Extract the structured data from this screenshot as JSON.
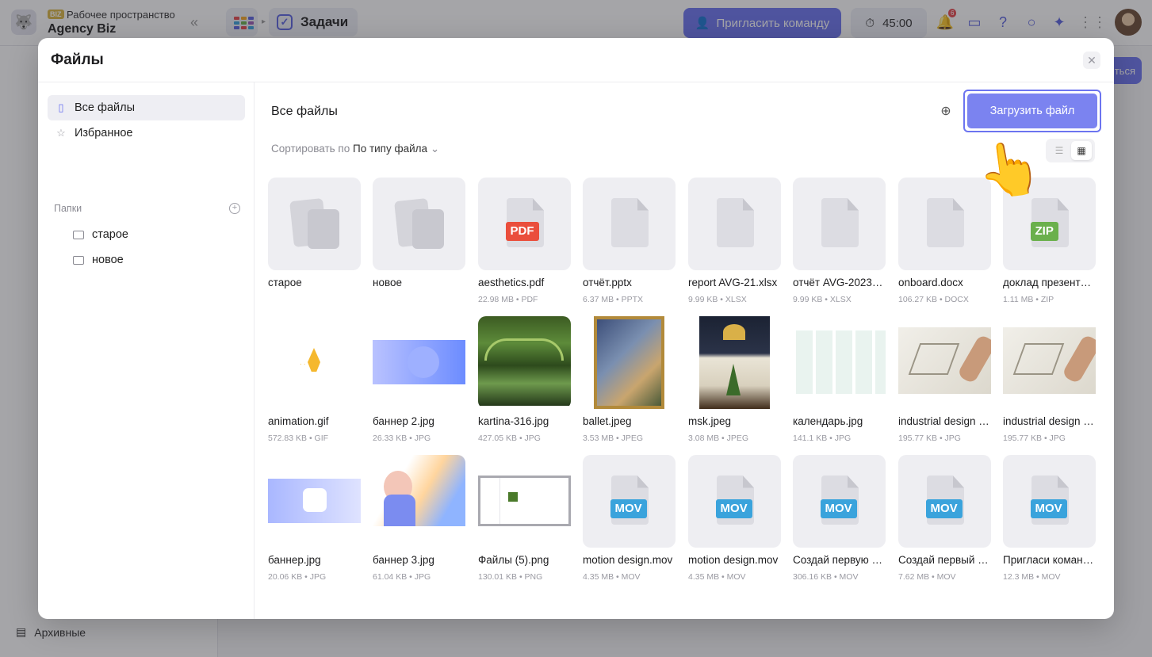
{
  "app": {
    "workspace_badge": "BIZ",
    "workspace_label": "Рабочее пространство",
    "workspace_name": "Agency Biz",
    "tasks_tab": "Задачи",
    "invite_button": "Пригласить команду",
    "timer": "45:00",
    "notifications_count": "6",
    "archive_label": "Архивные",
    "behind_button_fragment": "ться"
  },
  "modal": {
    "title": "Файлы",
    "sidebar": {
      "all_files": "Все файлы",
      "favorites": "Избранное",
      "folders_header": "Папки",
      "folders": [
        "старое",
        "новое"
      ]
    },
    "main": {
      "title": "Все файлы",
      "upload_button": "Загрузить файл",
      "sort_prefix": "Сортировать по",
      "sort_value": "По типу файла"
    },
    "files": [
      {
        "name": "старое",
        "meta": "",
        "kind": "folder"
      },
      {
        "name": "новое",
        "meta": "",
        "kind": "folder"
      },
      {
        "name": "aesthetics.pdf",
        "meta": "22.98 MB • PDF",
        "kind": "doc",
        "badge": "PDF",
        "badge_color": "#ea4e3c"
      },
      {
        "name": "отчёт.pptx",
        "meta": "6.37 MB • PPTX",
        "kind": "doc"
      },
      {
        "name": "report AVG-21.xlsx",
        "meta": "9.99 KB • XLSX",
        "kind": "doc"
      },
      {
        "name": "отчёт AVG-2023…",
        "meta": "9.99 KB • XLSX",
        "kind": "doc"
      },
      {
        "name": "onboard.docx",
        "meta": "106.27 KB • DOCX",
        "kind": "doc"
      },
      {
        "name": "доклад презент…",
        "meta": "1.11 MB • ZIP",
        "kind": "doc",
        "badge": "ZIP",
        "badge_color": "#6ab04c"
      },
      {
        "name": "animation.gif",
        "meta": "572.83 KB • GIF",
        "kind": "image",
        "img": "pen"
      },
      {
        "name": "баннер 2.jpg",
        "meta": "26.33 KB • JPG",
        "kind": "image",
        "img": "banner2"
      },
      {
        "name": "kartina-316.jpg",
        "meta": "427.05 KB • JPG",
        "kind": "image",
        "img": "monet"
      },
      {
        "name": "ballet.jpeg",
        "meta": "3.53 MB • JPEG",
        "kind": "image",
        "img": "ballet"
      },
      {
        "name": "msk.jpeg",
        "meta": "3.08 MB • JPEG",
        "kind": "image",
        "img": "msk"
      },
      {
        "name": "календарь.jpg",
        "meta": "141.1 KB • JPG",
        "kind": "image",
        "img": "calendar"
      },
      {
        "name": "industrial design …",
        "meta": "195.77 KB • JPG",
        "kind": "image",
        "img": "sketch"
      },
      {
        "name": "industrial design …",
        "meta": "195.77 KB • JPG",
        "kind": "image",
        "img": "sketch"
      },
      {
        "name": "баннер.jpg",
        "meta": "20.06 KB • JPG",
        "kind": "image",
        "img": "banner"
      },
      {
        "name": "баннер 3.jpg",
        "meta": "61.04 KB • JPG",
        "kind": "image",
        "img": "banner3"
      },
      {
        "name": "Файлы (5).png",
        "meta": "130.01 KB • PNG",
        "kind": "image",
        "img": "screenshot"
      },
      {
        "name": "motion design.mov",
        "meta": "4.35 MB • MOV",
        "kind": "doc",
        "badge": "MOV",
        "badge_color": "#3aa3dc"
      },
      {
        "name": "motion design.mov",
        "meta": "4.35 MB • MOV",
        "kind": "doc",
        "badge": "MOV",
        "badge_color": "#3aa3dc"
      },
      {
        "name": "Создай первую …",
        "meta": "306.16 KB • MOV",
        "kind": "doc",
        "badge": "MOV",
        "badge_color": "#3aa3dc"
      },
      {
        "name": "Создай первый …",
        "meta": "7.62 MB • MOV",
        "kind": "doc",
        "badge": "MOV",
        "badge_color": "#3aa3dc"
      },
      {
        "name": "Пригласи коман…",
        "meta": "12.3 MB • MOV",
        "kind": "doc",
        "badge": "MOV",
        "badge_color": "#3aa3dc"
      }
    ]
  },
  "colors": {
    "accent": "#6c74f0",
    "pdf": "#ea4e3c",
    "zip": "#6ab04c",
    "mov": "#3aa3dc"
  },
  "icons": [
    "workspace-logo-icon",
    "collapse-sidebar-icon",
    "apps-grid-icon",
    "checkbox-icon",
    "add-user-icon",
    "timer-icon",
    "bell-icon",
    "folder-icon",
    "help-icon",
    "search-icon",
    "sparkle-icon",
    "grid-icon",
    "close-icon",
    "file-icon",
    "star-icon",
    "add-circle-icon",
    "new-folder-icon",
    "chevron-down-icon",
    "list-view-icon",
    "grid-view-icon",
    "pointing-hand-icon"
  ]
}
